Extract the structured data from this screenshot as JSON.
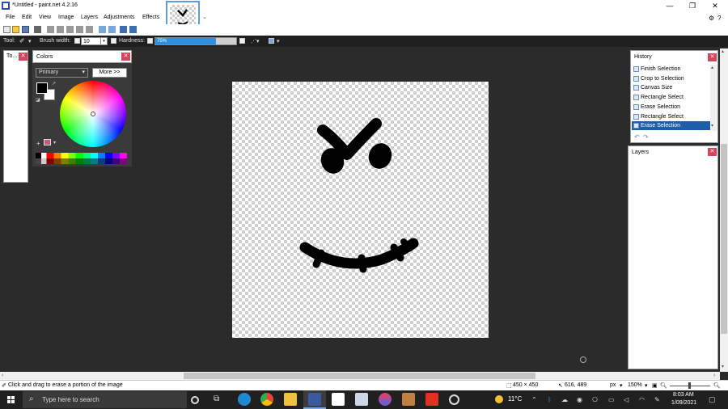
{
  "window": {
    "title": "*Untitled - paint.net 4.2.16"
  },
  "menu": [
    "File",
    "Edit",
    "View",
    "Image",
    "Layers",
    "Adjustments",
    "Effects"
  ],
  "toolbar": {
    "tool_label": "Tool:",
    "brush_width_label": "Brush width:",
    "brush_width_value": "10",
    "hardness_label": "Hardness:",
    "hardness_value": "75%",
    "hardness_fraction": 0.75
  },
  "tools_panel": {
    "title": "To..."
  },
  "colors_panel": {
    "title": "Colors",
    "mode_selected": "Primary",
    "more_button": "More >>",
    "primary_color": "#000000",
    "secondary_color": "#ffffff"
  },
  "history_panel": {
    "title": "History",
    "items": [
      {
        "label": "Finish Selection",
        "selected": false
      },
      {
        "label": "Crop to Selection",
        "selected": false
      },
      {
        "label": "Canvas Size",
        "selected": false
      },
      {
        "label": "Rectangle Select",
        "selected": false
      },
      {
        "label": "Erase Selection",
        "selected": false
      },
      {
        "label": "Rectangle Select",
        "selected": false
      },
      {
        "label": "Erase Selection",
        "selected": true
      }
    ]
  },
  "layers_panel": {
    "title": "Layers"
  },
  "status": {
    "hint": "Click and drag to erase a portion of the image",
    "image_size": "450 × 450",
    "cursor_pos": "616, 489",
    "units": "px",
    "zoom": "150%"
  },
  "taskbar": {
    "search_placeholder": "Type here to search",
    "weather": "11°C",
    "time": "8:03 AM",
    "date": "1/09/2021"
  },
  "colors": {
    "accent": "#1c5fa8",
    "close": "#d9435b",
    "hardness_fill": "#2d8fe0"
  }
}
